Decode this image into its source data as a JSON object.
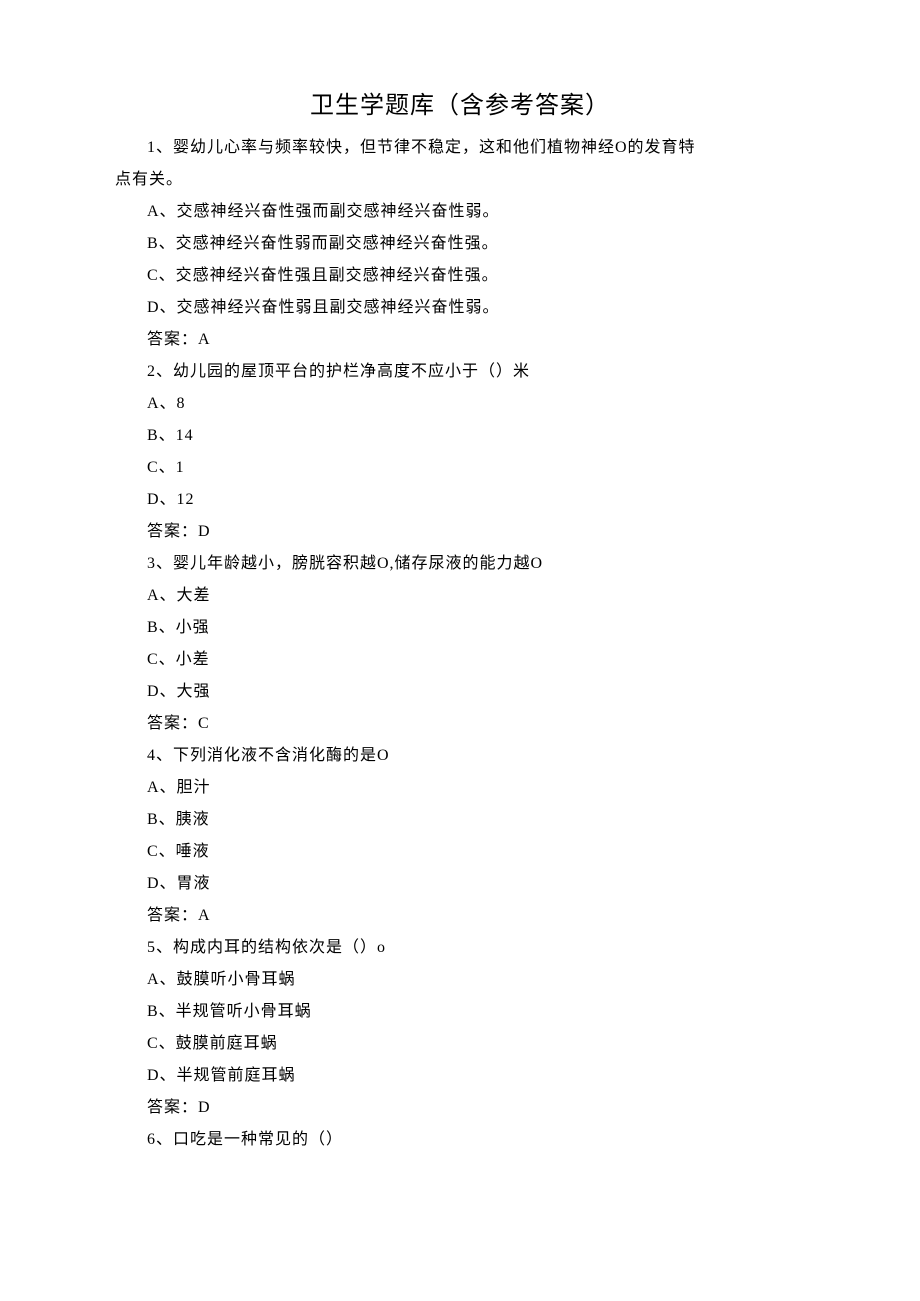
{
  "title": "卫生学题库（含参考答案）",
  "lines": [
    {
      "text": "1、婴幼儿心率与频率较快，但节律不稳定，这和他们植物神经O的发育特",
      "indent": true
    },
    {
      "text": "点有关。",
      "indent": false
    },
    {
      "text": "A、交感神经兴奋性强而副交感神经兴奋性弱。",
      "indent": true
    },
    {
      "text": "B、交感神经兴奋性弱而副交感神经兴奋性强。",
      "indent": true
    },
    {
      "text": "C、交感神经兴奋性强且副交感神经兴奋性强。",
      "indent": true
    },
    {
      "text": "D、交感神经兴奋性弱且副交感神经兴奋性弱。",
      "indent": true
    },
    {
      "text": "答案：A",
      "indent": true
    },
    {
      "text": "2、幼儿园的屋顶平台的护栏净高度不应小于（）米",
      "indent": true
    },
    {
      "text": "A、8",
      "indent": true
    },
    {
      "text": "B、14",
      "indent": true
    },
    {
      "text": "C、1",
      "indent": true
    },
    {
      "text": "D、12",
      "indent": true
    },
    {
      "text": "答案：D",
      "indent": true
    },
    {
      "text": "3、婴儿年龄越小，膀胱容积越O,储存尿液的能力越O",
      "indent": true
    },
    {
      "text": "A、大差",
      "indent": true
    },
    {
      "text": "B、小强",
      "indent": true
    },
    {
      "text": "C、小差",
      "indent": true
    },
    {
      "text": "D、大强",
      "indent": true
    },
    {
      "text": "答案：C",
      "indent": true
    },
    {
      "text": "4、下列消化液不含消化酶的是O",
      "indent": true
    },
    {
      "text": "A、胆汁",
      "indent": true
    },
    {
      "text": "B、胰液",
      "indent": true
    },
    {
      "text": "C、唾液",
      "indent": true
    },
    {
      "text": "D、胃液",
      "indent": true
    },
    {
      "text": "答案：A",
      "indent": true
    },
    {
      "text": "5、构成内耳的结构依次是（）o",
      "indent": true
    },
    {
      "text": "A、鼓膜听小骨耳蜗",
      "indent": true
    },
    {
      "text": "B、半规管听小骨耳蜗",
      "indent": true
    },
    {
      "text": "C、鼓膜前庭耳蜗",
      "indent": true
    },
    {
      "text": "D、半规管前庭耳蜗",
      "indent": true
    },
    {
      "text": "答案：D",
      "indent": true
    },
    {
      "text": "6、口吃是一种常见的（）",
      "indent": true
    }
  ]
}
